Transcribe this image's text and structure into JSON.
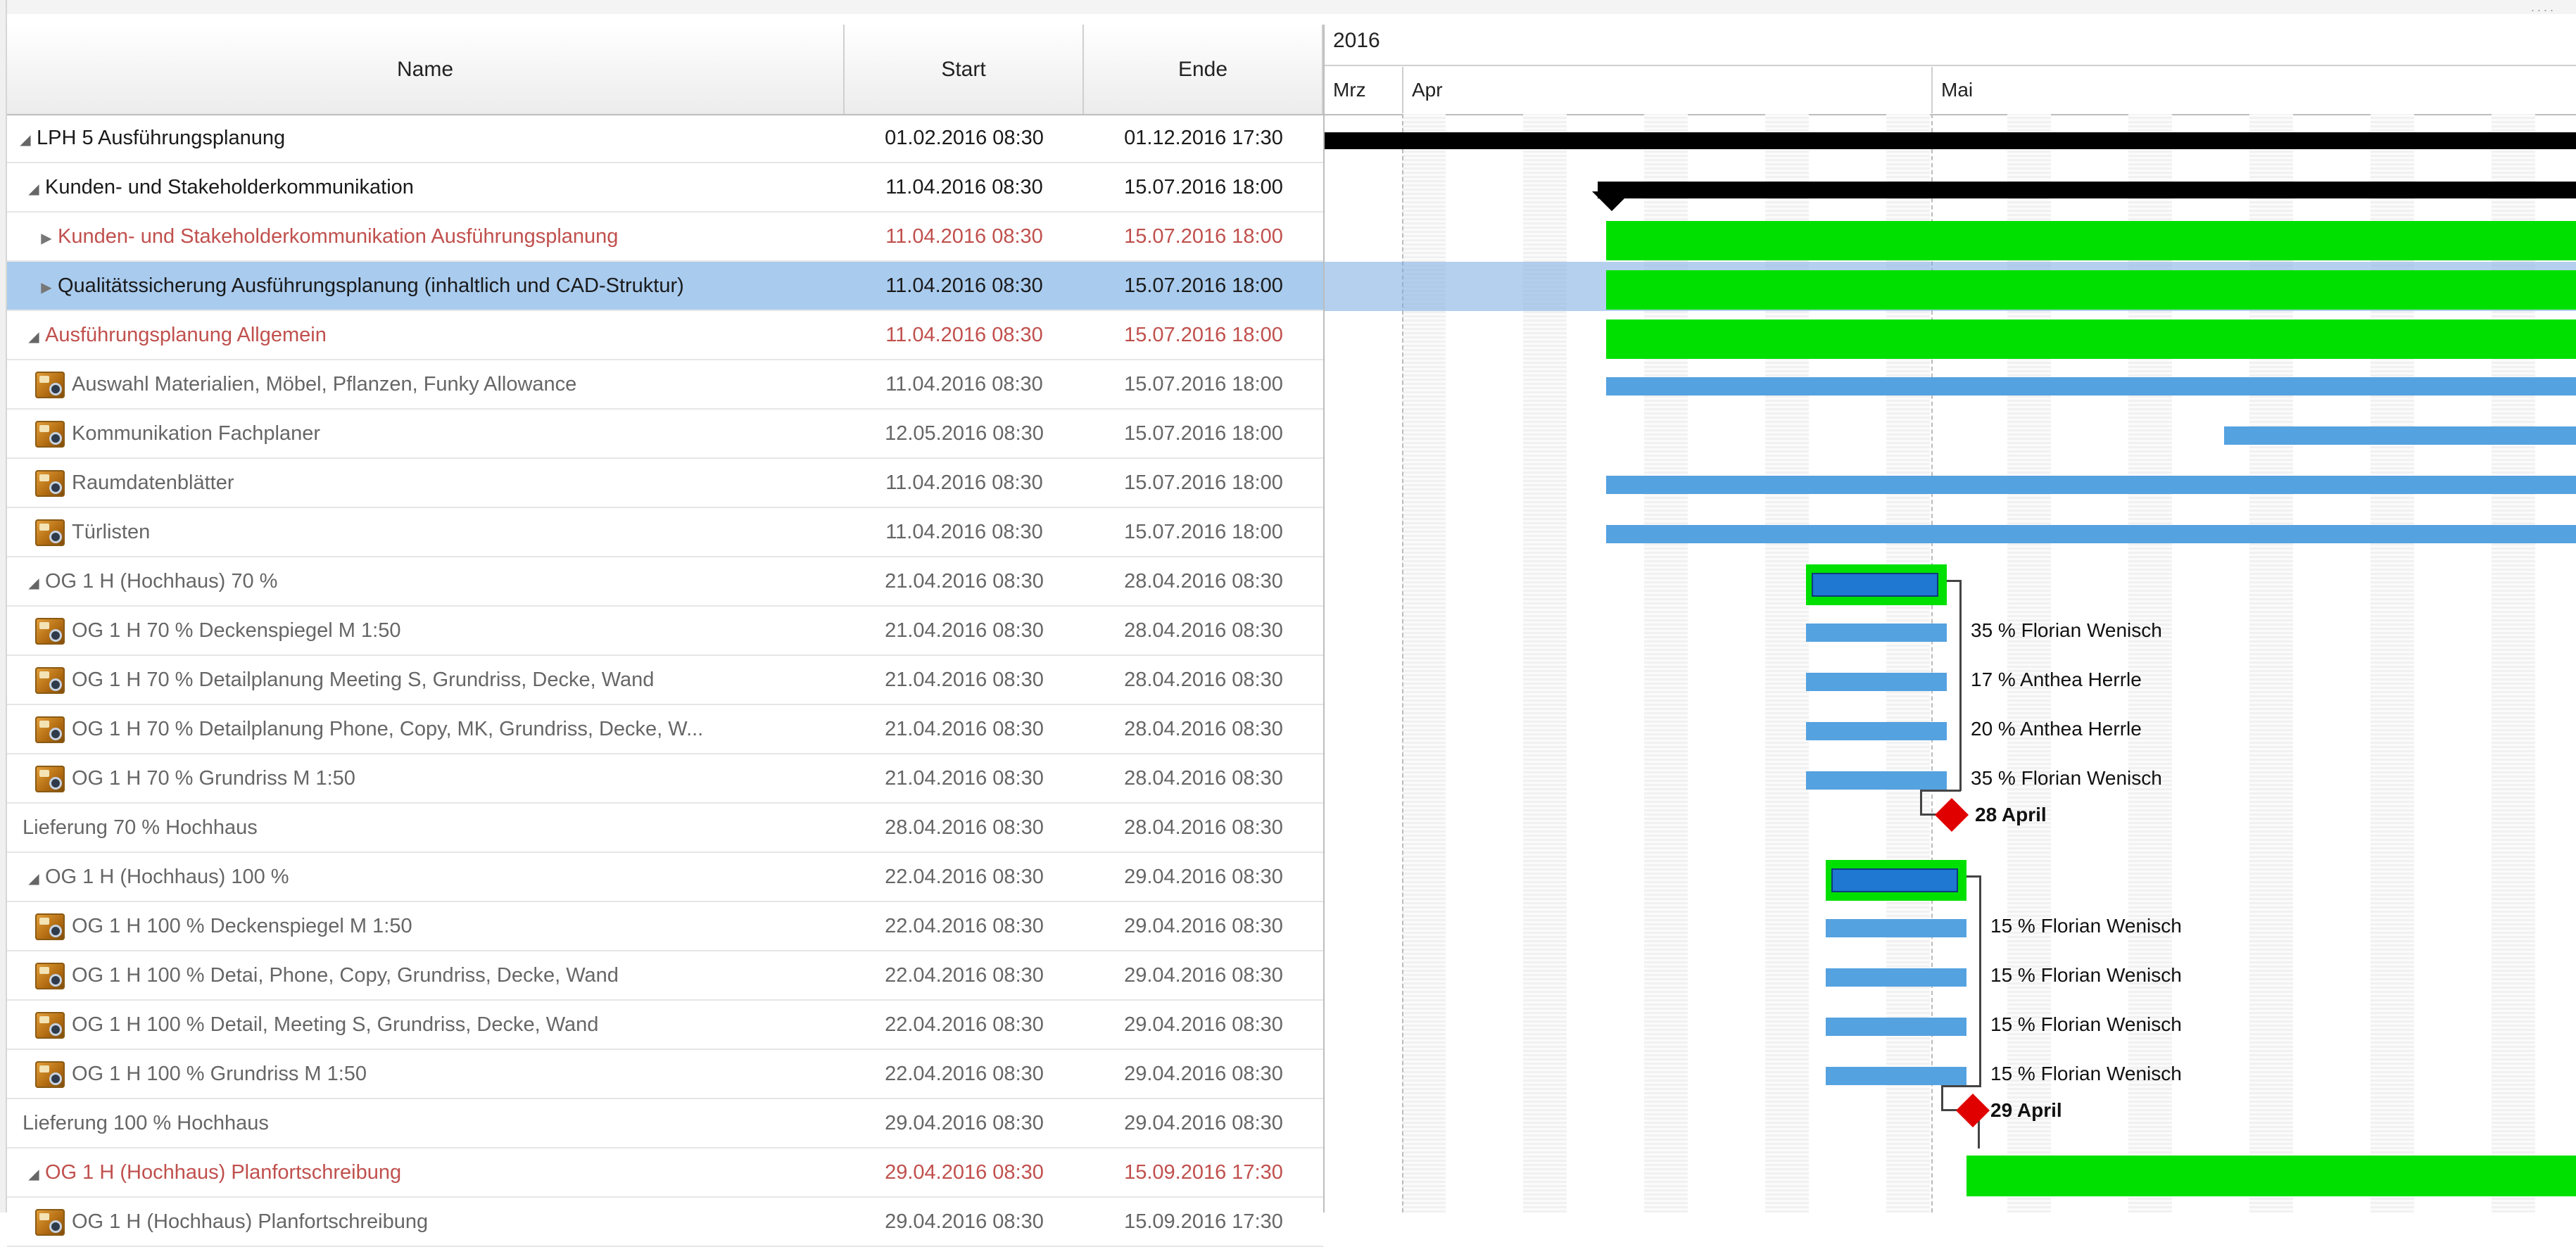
{
  "columns": {
    "name": "Name",
    "start": "Start",
    "end": "Ende"
  },
  "timeline": {
    "year": "2016",
    "months": [
      "Mrz",
      "Apr",
      "Mai"
    ]
  },
  "window_dots": "....",
  "rows": [
    {
      "name": "LPH 5 Ausführungsplanung",
      "start": "01.02.2016 08:30",
      "end": "01.12.2016 17:30",
      "level": 0,
      "expander": "expanded",
      "color": "black",
      "icon": ""
    },
    {
      "name": "Kunden- und Stakeholderkommunikation",
      "start": "11.04.2016 08:30",
      "end": "15.07.2016 18:00",
      "level": 1,
      "expander": "expanded",
      "color": "black",
      "icon": ""
    },
    {
      "name": "Kunden- und Stakeholderkommunikation Ausführungsplanung",
      "start": "11.04.2016 08:30",
      "end": "15.07.2016 18:00",
      "level": 2,
      "expander": "collapsed",
      "color": "red",
      "icon": ""
    },
    {
      "name": "Qualitätssicherung Ausführungsplanung (inhaltlich und CAD-Struktur)",
      "start": "11.04.2016 08:30",
      "end": "15.07.2016 18:00",
      "level": 2,
      "expander": "collapsed",
      "color": "black",
      "icon": "",
      "selected": true
    },
    {
      "name": "Ausführungsplanung Allgemein",
      "start": "11.04.2016 08:30",
      "end": "15.07.2016 18:00",
      "level": 1,
      "expander": "expanded",
      "color": "red",
      "icon": ""
    },
    {
      "name": "Auswahl Materialien, Möbel, Pflanzen, Funky Allowance",
      "start": "11.04.2016 08:30",
      "end": "15.07.2016 18:00",
      "level": 2,
      "expander": "none",
      "color": "gray",
      "icon": "task-icon"
    },
    {
      "name": "Kommunikation Fachplaner",
      "start": "12.05.2016 08:30",
      "end": "15.07.2016 18:00",
      "level": 2,
      "expander": "none",
      "color": "gray",
      "icon": "task-icon"
    },
    {
      "name": "Raumdatenblätter",
      "start": "11.04.2016 08:30",
      "end": "15.07.2016 18:00",
      "level": 2,
      "expander": "none",
      "color": "gray",
      "icon": "task-icon"
    },
    {
      "name": "Türlisten",
      "start": "11.04.2016 08:30",
      "end": "15.07.2016 18:00",
      "level": 2,
      "expander": "none",
      "color": "gray",
      "icon": "task-icon"
    },
    {
      "name": "OG 1 H (Hochhaus) 70 %",
      "start": "21.04.2016 08:30",
      "end": "28.04.2016 08:30",
      "level": 1,
      "expander": "expanded",
      "color": "gray",
      "icon": ""
    },
    {
      "name": "OG 1 H 70 % Deckenspiegel M 1:50",
      "start": "21.04.2016 08:30",
      "end": "28.04.2016 08:30",
      "level": 2,
      "expander": "none",
      "color": "gray",
      "icon": "task-icon"
    },
    {
      "name": "OG 1 H 70 % Detailplanung Meeting S, Grundriss, Decke, Wand",
      "start": "21.04.2016 08:30",
      "end": "28.04.2016 08:30",
      "level": 2,
      "expander": "none",
      "color": "gray",
      "icon": "task-icon"
    },
    {
      "name": "OG 1 H 70 % Detailplanung Phone, Copy, MK, Grundriss, Decke, W...",
      "start": "21.04.2016 08:30",
      "end": "28.04.2016 08:30",
      "level": 2,
      "expander": "none",
      "color": "gray",
      "icon": "task-icon"
    },
    {
      "name": "OG 1 H 70 % Grundriss M 1:50",
      "start": "21.04.2016 08:30",
      "end": "28.04.2016 08:30",
      "level": 2,
      "expander": "none",
      "color": "gray",
      "icon": "task-icon"
    },
    {
      "name": "Lieferung  70 % Hochhaus",
      "start": "28.04.2016 08:30",
      "end": "28.04.2016 08:30",
      "level": 1,
      "expander": "none",
      "color": "gray",
      "icon": ""
    },
    {
      "name": "OG 1 H (Hochhaus) 100 %",
      "start": "22.04.2016 08:30",
      "end": "29.04.2016 08:30",
      "level": 1,
      "expander": "expanded",
      "color": "gray",
      "icon": ""
    },
    {
      "name": "OG 1 H 100 % Deckenspiegel M 1:50",
      "start": "22.04.2016 08:30",
      "end": "29.04.2016 08:30",
      "level": 2,
      "expander": "none",
      "color": "gray",
      "icon": "task-icon"
    },
    {
      "name": "OG 1 H 100 % Detai, Phone, Copy, Grundriss, Decke, Wand",
      "start": "22.04.2016 08:30",
      "end": "29.04.2016 08:30",
      "level": 2,
      "expander": "none",
      "color": "gray",
      "icon": "task-icon"
    },
    {
      "name": "OG 1 H 100 % Detail, Meeting S, Grundriss, Decke, Wand",
      "start": "22.04.2016 08:30",
      "end": "29.04.2016 08:30",
      "level": 2,
      "expander": "none",
      "color": "gray",
      "icon": "task-icon"
    },
    {
      "name": "OG 1 H 100 % Grundriss M 1:50",
      "start": "22.04.2016 08:30",
      "end": "29.04.2016 08:30",
      "level": 2,
      "expander": "none",
      "color": "gray",
      "icon": "task-icon"
    },
    {
      "name": "Lieferung 100 % Hochhaus",
      "start": "29.04.2016 08:30",
      "end": "29.04.2016 08:30",
      "level": 1,
      "expander": "none",
      "color": "gray",
      "icon": ""
    },
    {
      "name": "OG 1 H (Hochhaus) Planfortschreibung",
      "start": "29.04.2016 08:30",
      "end": "15.09.2016 17:30",
      "level": 1,
      "expander": "expanded",
      "color": "red",
      "icon": ""
    },
    {
      "name": "OG 1 H (Hochhaus) Planfortschreibung",
      "start": "29.04.2016 08:30",
      "end": "15.09.2016 17:30",
      "level": 2,
      "expander": "none",
      "color": "gray",
      "icon": "task-icon"
    }
  ],
  "gantt": {
    "colors": {
      "summary": "#000000",
      "group": "#00e000",
      "task": "#55a2e0",
      "progress": "#1f78d2",
      "milestone": "#e00000",
      "selection": "#a9cbee"
    },
    "bar_labels": {
      "r10": "35 % Florian Wenisch",
      "r11": "17 % Anthea Herrle",
      "r12": "20 % Anthea Herrle",
      "r13": "35 % Florian Wenisch",
      "r14": "28 April",
      "r16": "15 % Florian Wenisch",
      "r17": "15 % Florian Wenisch",
      "r18": "15 % Florian Wenisch",
      "r19": "15 % Florian Wenisch",
      "r20": "29 April"
    }
  }
}
